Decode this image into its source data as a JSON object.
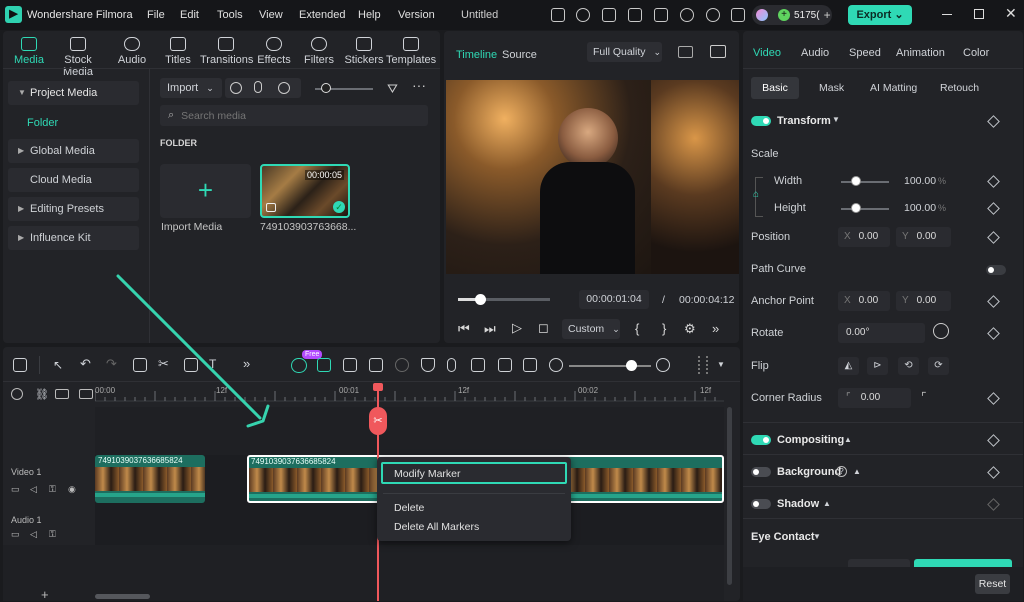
{
  "titlebar": {
    "app_name": "Wondershare Filmora",
    "menus": [
      "File",
      "Edit",
      "Tools",
      "View",
      "Extended",
      "Help",
      "Version"
    ],
    "project": "Untitled",
    "credits": "5175(",
    "export_label": "Export"
  },
  "ribbon": {
    "items": [
      {
        "label": "Media",
        "icon": "media-icon"
      },
      {
        "label": "Stock Media",
        "icon": "stock-media-icon"
      },
      {
        "label": "Audio",
        "icon": "music-icon"
      },
      {
        "label": "Titles",
        "icon": "text-icon"
      },
      {
        "label": "Transitions",
        "icon": "transitions-icon"
      },
      {
        "label": "Effects",
        "icon": "effects-icon"
      },
      {
        "label": "Filters",
        "icon": "filters-icon"
      },
      {
        "label": "Stickers",
        "icon": "stickers-icon"
      },
      {
        "label": "Templates",
        "icon": "templates-icon"
      }
    ]
  },
  "sidebar": {
    "items": [
      "Project Media",
      "Folder",
      "Global Media",
      "Cloud Media",
      "Editing Presets",
      "Influence Kit"
    ]
  },
  "media": {
    "import_label": "Import",
    "search_placeholder": "Search media",
    "folder_header": "FOLDER",
    "import_tile_label": "Import Media",
    "clip_name": "749103903763668...",
    "clip_duration": "00:00:05"
  },
  "preview": {
    "tab_timeline": "Timeline",
    "tab_source": "Source",
    "quality": "Full Quality",
    "current_time": "00:00:01:04",
    "separator": "/",
    "total_time": "00:00:04:12",
    "custom_label": "Custom",
    "progress": 0.24
  },
  "properties": {
    "tabs": [
      "Video",
      "Audio",
      "Speed",
      "Animation",
      "Color"
    ],
    "subtabs": [
      "Basic",
      "Mask",
      "AI Matting",
      "Retouch"
    ],
    "transform": "Transform",
    "scale": "Scale",
    "width_label": "Width",
    "width_value": "100.00",
    "height_label": "Height",
    "height_value": "100.00",
    "percent": "%",
    "position": "Position",
    "x_label": "X",
    "y_label": "Y",
    "pos_x": "0.00",
    "pos_y": "0.00",
    "path_curve": "Path Curve",
    "anchor_point": "Anchor Point",
    "anchor_x": "0.00",
    "anchor_y": "0.00",
    "rotate": "Rotate",
    "rotate_value": "0.00°",
    "flip": "Flip",
    "corner_radius": "Corner Radius",
    "corner_value": "0.00",
    "compositing": "Compositing",
    "background": "Background",
    "shadow": "Shadow",
    "eye_contact": "Eye Contact",
    "reset": "Reset"
  },
  "timeline": {
    "ruler": [
      "00:00",
      "12f",
      "00:01",
      "12f",
      "00:02",
      "12f"
    ],
    "video_track": "Video 1",
    "audio_track": "Audio 1",
    "clip1_name": "7491039037636685824",
    "clip2_name": "7491039037636685824",
    "new_badge": "Free"
  },
  "context_menu": {
    "items": [
      "Modify Marker",
      "Delete",
      "Delete All Markers"
    ]
  },
  "colors": {
    "accent": "#2fd9b5",
    "playhead": "#f0585c"
  }
}
